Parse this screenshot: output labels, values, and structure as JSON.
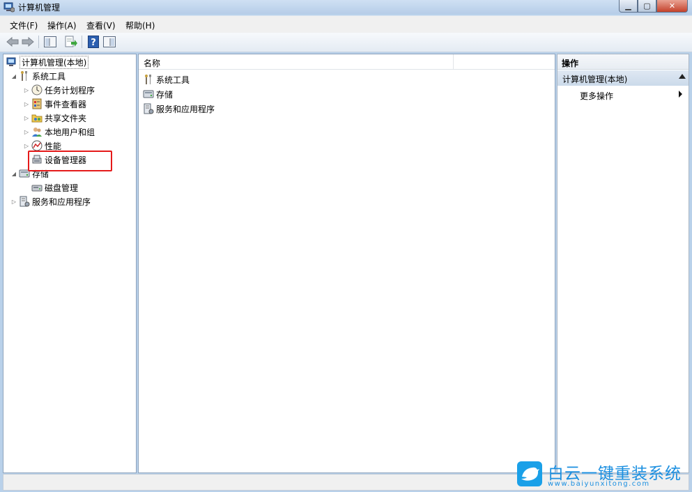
{
  "window": {
    "title": "计算机管理"
  },
  "menu": [
    "文件(F)",
    "操作(A)",
    "查看(V)",
    "帮助(H)"
  ],
  "tree": {
    "root": "计算机管理(本地)",
    "system_tools": "系统工具",
    "task_scheduler": "任务计划程序",
    "event_viewer": "事件查看器",
    "shared_folders": "共享文件夹",
    "local_users": "本地用户和组",
    "performance": "性能",
    "device_manager": "设备管理器",
    "storage": "存储",
    "disk_management": "磁盘管理",
    "services_apps": "服务和应用程序"
  },
  "list": {
    "column_name": "名称",
    "items": [
      "系统工具",
      "存储",
      "服务和应用程序"
    ]
  },
  "actions": {
    "header": "操作",
    "section": "计算机管理(本地)",
    "more": "更多操作"
  },
  "watermark": {
    "title": "白云一键重装系统",
    "url": "www.baiyunxitong.com"
  },
  "colors": {
    "highlight_box": "#e51a1a",
    "watermark": "#1b8fe0"
  }
}
